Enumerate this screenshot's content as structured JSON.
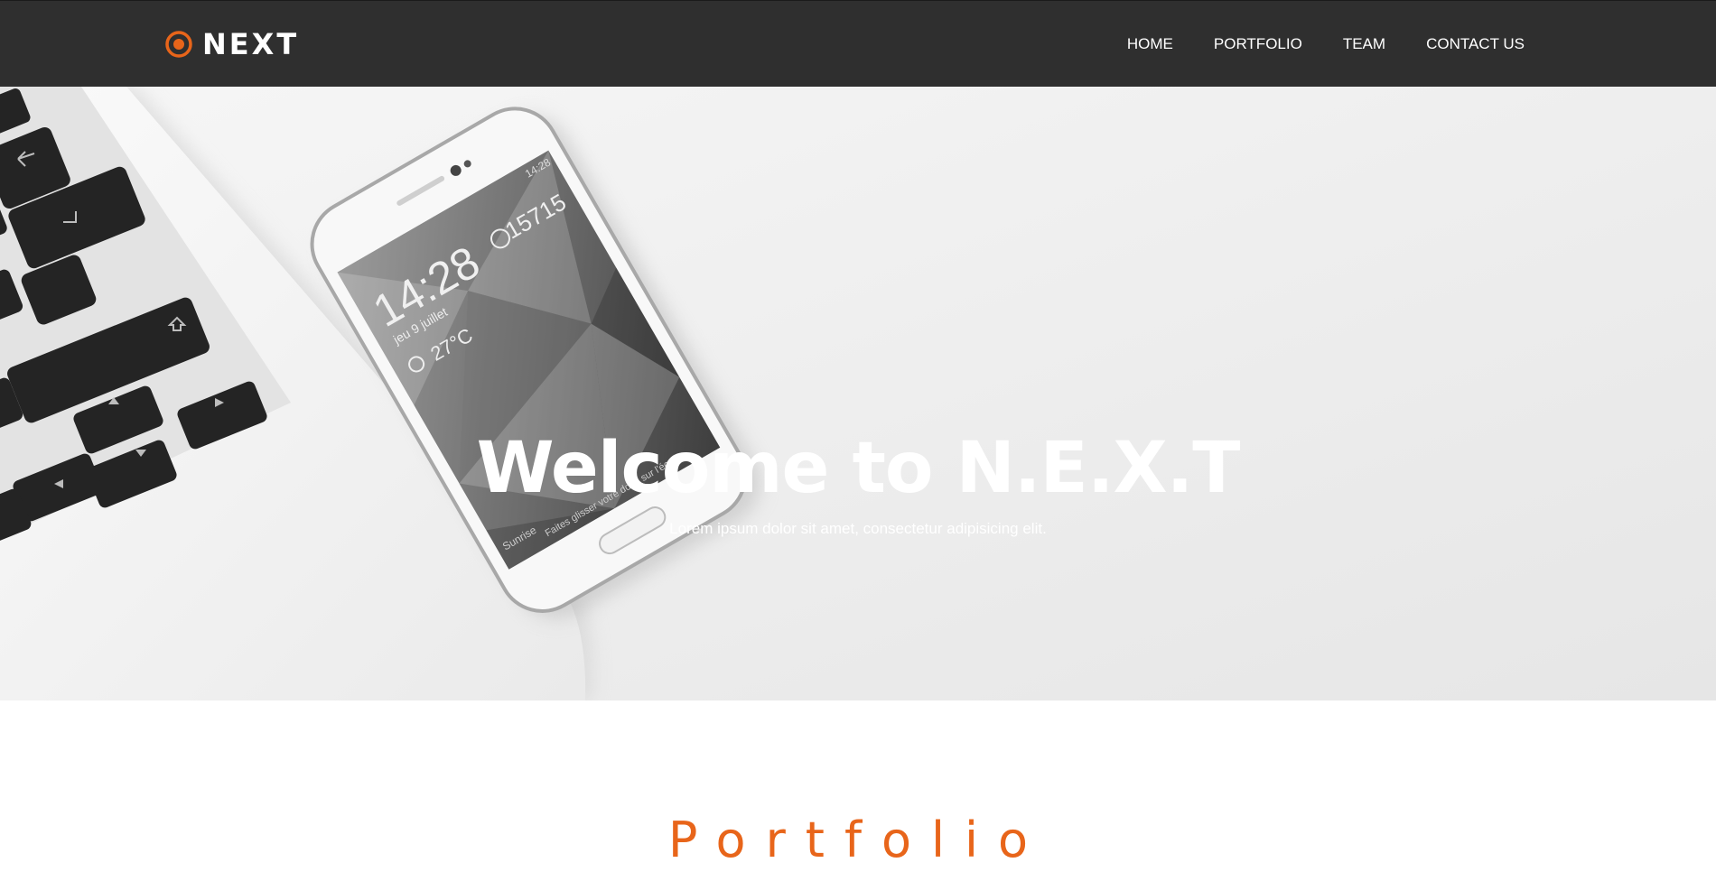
{
  "nav": {
    "brand": "NEXT",
    "items": [
      {
        "label": "HOME"
      },
      {
        "label": "PORTFOLIO"
      },
      {
        "label": "TEAM"
      },
      {
        "label": "CONTACT US"
      }
    ]
  },
  "hero": {
    "title": "Welcome to N.E.X.T",
    "subtitle": "Lorem ipsum dolor sit amet, consectetur adipisicing elit.",
    "phone_screen": {
      "status_time": "14:28",
      "clock": "14:28",
      "date": "jeu 9 juillet",
      "temperature": "27°C",
      "steps": "15715",
      "labels": [
        "Sunrise",
        "Faites glisser votre doigt sur l'écran"
      ]
    }
  },
  "portfolio": {
    "title": "Portfolio"
  },
  "colors": {
    "accent": "#e8651a",
    "navbar": "#2f2f2f",
    "text_light": "#ffffff"
  },
  "icons": {
    "brand_logo": "target-circle-icon"
  }
}
